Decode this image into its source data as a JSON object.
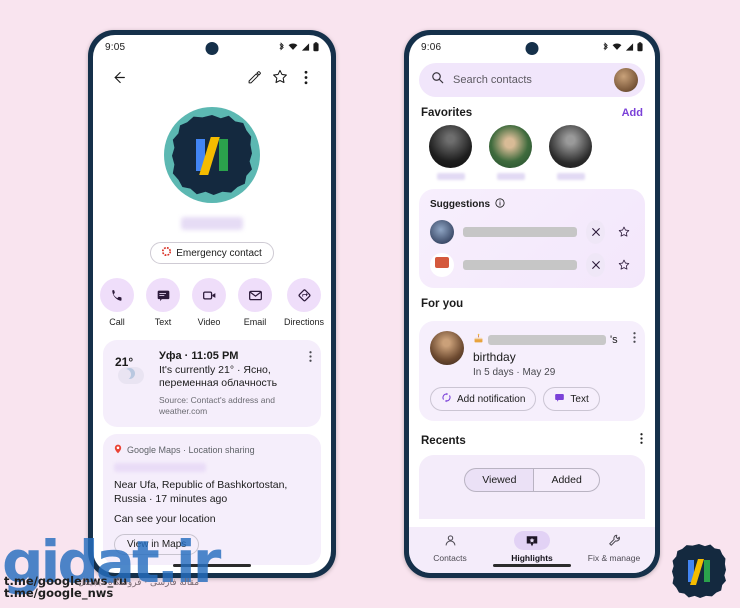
{
  "background_color": "#f9e4ef",
  "frame_color": "#15304a",
  "accent_color": "#7b41d8",
  "left_phone": {
    "status": {
      "time": "9:05",
      "icons": [
        "bluetooth-icon",
        "wifi-icon",
        "signal-icon",
        "battery-icon"
      ]
    },
    "toolbar": {
      "back_label": "back-arrow-icon",
      "edit_label": "pencil-icon",
      "star_label": "star-icon",
      "overflow_label": "more-vert-icon"
    },
    "contact": {
      "avatar_alt": "contact-photo",
      "name_redacted": true,
      "emergency_chip": "Emergency contact"
    },
    "actions": [
      {
        "label": "Call",
        "icon": "phone-icon"
      },
      {
        "label": "Text",
        "icon": "message-icon"
      },
      {
        "label": "Video",
        "icon": "videocam-icon"
      },
      {
        "label": "Email",
        "icon": "mail-icon"
      },
      {
        "label": "Directions",
        "icon": "directions-icon"
      }
    ],
    "weather_card": {
      "temp": "21°",
      "title": "Уфа · 11:05 PM",
      "description": "It's currently 21° · Ясно, переменная облачность",
      "source": "Source: Contact's address and weather.com"
    },
    "maps_card": {
      "header": "Google Maps · Location sharing",
      "name_redacted": true,
      "location": "Near Ufa, Republic of Bashkortostan, Russia · 17 minutes ago",
      "permission": "Can see your location",
      "button": "View in Maps"
    }
  },
  "right_phone": {
    "status": {
      "time": "9:06",
      "icons": [
        "bluetooth-icon",
        "wifi-icon",
        "signal-icon",
        "battery-icon"
      ]
    },
    "search": {
      "placeholder": "Search contacts",
      "icon": "search-icon",
      "avatar": "account-avatar"
    },
    "favorites": {
      "title": "Favorites",
      "action": "Add",
      "items": [
        {
          "name_redacted": true
        },
        {
          "name_redacted": true
        },
        {
          "name_redacted": true
        }
      ]
    },
    "suggestions": {
      "title": "Suggestions",
      "info_icon": "info-icon",
      "rows": [
        {
          "name_redacted": true,
          "dismiss": "close-icon",
          "favorite": "star-icon"
        },
        {
          "name_redacted": true,
          "dismiss": "close-icon",
          "favorite": "star-icon"
        }
      ]
    },
    "for_you": {
      "title": "For you",
      "card": {
        "emoji": "birthday-cake-icon",
        "name_redacted": true,
        "possessive": "'s",
        "event": "birthday",
        "subtitle": "In 5 days · May 29",
        "buttons": [
          {
            "label": "Add notification",
            "icon": "notification-add-icon"
          },
          {
            "label": "Text",
            "icon": "message-icon"
          }
        ],
        "overflow": "more-vert-icon"
      }
    },
    "recents": {
      "title": "Recents",
      "overflow": "more-vert-icon",
      "segments": [
        {
          "label": "Viewed",
          "selected": true
        },
        {
          "label": "Added",
          "selected": false
        }
      ]
    },
    "bottom_nav": [
      {
        "label": "Contacts",
        "icon": "person-icon",
        "selected": false
      },
      {
        "label": "Highlights",
        "icon": "highlights-icon",
        "selected": true
      },
      {
        "label": "Fix & manage",
        "icon": "wrench-icon",
        "selected": false
      }
    ]
  },
  "watermarks": {
    "logo_text": "gidat",
    "logo_text_2": ".ir",
    "telegram_1": "t.me/googlenws_ru",
    "telegram_2": "t.me/google_nws",
    "farsi": "مقاله فارسی · فروشگاه دیجیتال"
  }
}
